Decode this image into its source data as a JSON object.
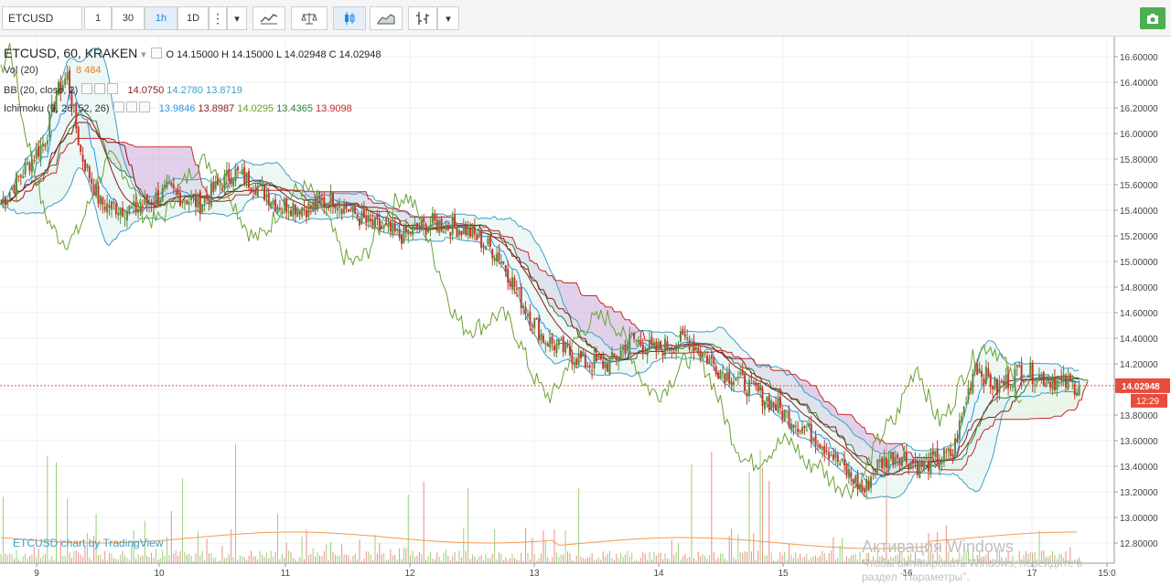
{
  "toolbar": {
    "symbol": "ETCUSD",
    "intervals": [
      "1",
      "30",
      "1h",
      "1D"
    ],
    "active_interval": "1h",
    "more_glyph": "⋮",
    "dropdown_glyph": "▾"
  },
  "legend": {
    "title": "ETCUSD, 60, KRAKEN",
    "ohlc": "O 14.15000  H 14.15000  L 14.02948  C 14.02948",
    "vol_label": "Vol (20)",
    "vol_values": "8  484",
    "bb_label": "BB (20, close, 2)",
    "bb_values": [
      "14.0750",
      "14.2780",
      "13.8719"
    ],
    "ichimoku_label": "Ichimoku (9, 26, 52, 26)",
    "ichimoku_values": [
      "13.9846",
      "13.8987",
      "14.0295",
      "13.4365",
      "13.9098"
    ]
  },
  "price_axis": {
    "ticks": [
      "16.60000",
      "16.40000",
      "16.20000",
      "16.00000",
      "15.80000",
      "15.60000",
      "15.40000",
      "15.20000",
      "15.00000",
      "14.80000",
      "14.60000",
      "14.40000",
      "14.20000",
      "14.00000",
      "13.80000",
      "13.60000",
      "13.40000",
      "13.20000",
      "13.00000",
      "12.80000"
    ],
    "last_price": "14.02948",
    "countdown": "12:29"
  },
  "time_axis": {
    "ticks": [
      "9",
      "10",
      "11",
      "12",
      "13",
      "14",
      "15",
      "16",
      "17",
      "15:0"
    ]
  },
  "attribution": "ETCUSD chart by TradingView",
  "watermark": {
    "title": "Активация Windows",
    "line1": "Чтобы активировать Windows, перейдите в",
    "line2": "раздел \"Параметры\"."
  },
  "colors": {
    "up_candle": "#5b8a3a",
    "down_candle": "#c0392b",
    "bb": "#3da0c5",
    "tenkan": "#2196f3",
    "kijun": "#8b1a1a",
    "chikou": "#6aa232",
    "span_a": "#2e7d32",
    "span_b": "#c62828",
    "cloud_bear": "#c9a8d8",
    "volume_ma": "#f39c52",
    "last_price_tag": "#e74c3c"
  },
  "chart_data": {
    "type": "candlestick",
    "symbol": "ETCUSD",
    "exchange": "KRAKEN",
    "interval": "60",
    "ylim": [
      12.8,
      16.6
    ],
    "x_day_labels": [
      "9",
      "10",
      "11",
      "12",
      "13",
      "14",
      "15",
      "16",
      "17"
    ],
    "price_anchors": [
      [
        0,
        15.45
      ],
      [
        10,
        15.7
      ],
      [
        20,
        15.95
      ],
      [
        25,
        16.3
      ],
      [
        30,
        16.45
      ],
      [
        36,
        15.85
      ],
      [
        45,
        15.45
      ],
      [
        60,
        15.4
      ],
      [
        75,
        15.55
      ],
      [
        90,
        15.45
      ],
      [
        105,
        15.7
      ],
      [
        115,
        15.6
      ],
      [
        125,
        15.45
      ],
      [
        140,
        15.42
      ],
      [
        150,
        15.5
      ],
      [
        165,
        15.3
      ],
      [
        180,
        15.2
      ],
      [
        195,
        15.3
      ],
      [
        210,
        15.25
      ],
      [
        225,
        15.05
      ],
      [
        235,
        14.7
      ],
      [
        245,
        14.4
      ],
      [
        255,
        14.3
      ],
      [
        265,
        14.2
      ],
      [
        275,
        14.2
      ],
      [
        285,
        14.4
      ],
      [
        295,
        14.3
      ],
      [
        310,
        14.4
      ],
      [
        325,
        14.15
      ],
      [
        340,
        14.0
      ],
      [
        355,
        13.8
      ],
      [
        370,
        13.6
      ],
      [
        380,
        13.4
      ],
      [
        390,
        13.2
      ],
      [
        395,
        13.4
      ],
      [
        405,
        13.5
      ],
      [
        415,
        13.4
      ],
      [
        430,
        13.5
      ],
      [
        440,
        14.2
      ],
      [
        450,
        14.0
      ],
      [
        460,
        14.15
      ],
      [
        470,
        14.1
      ],
      [
        480,
        14.05
      ],
      [
        487,
        14.03
      ]
    ],
    "last_close": 14.02948
  }
}
